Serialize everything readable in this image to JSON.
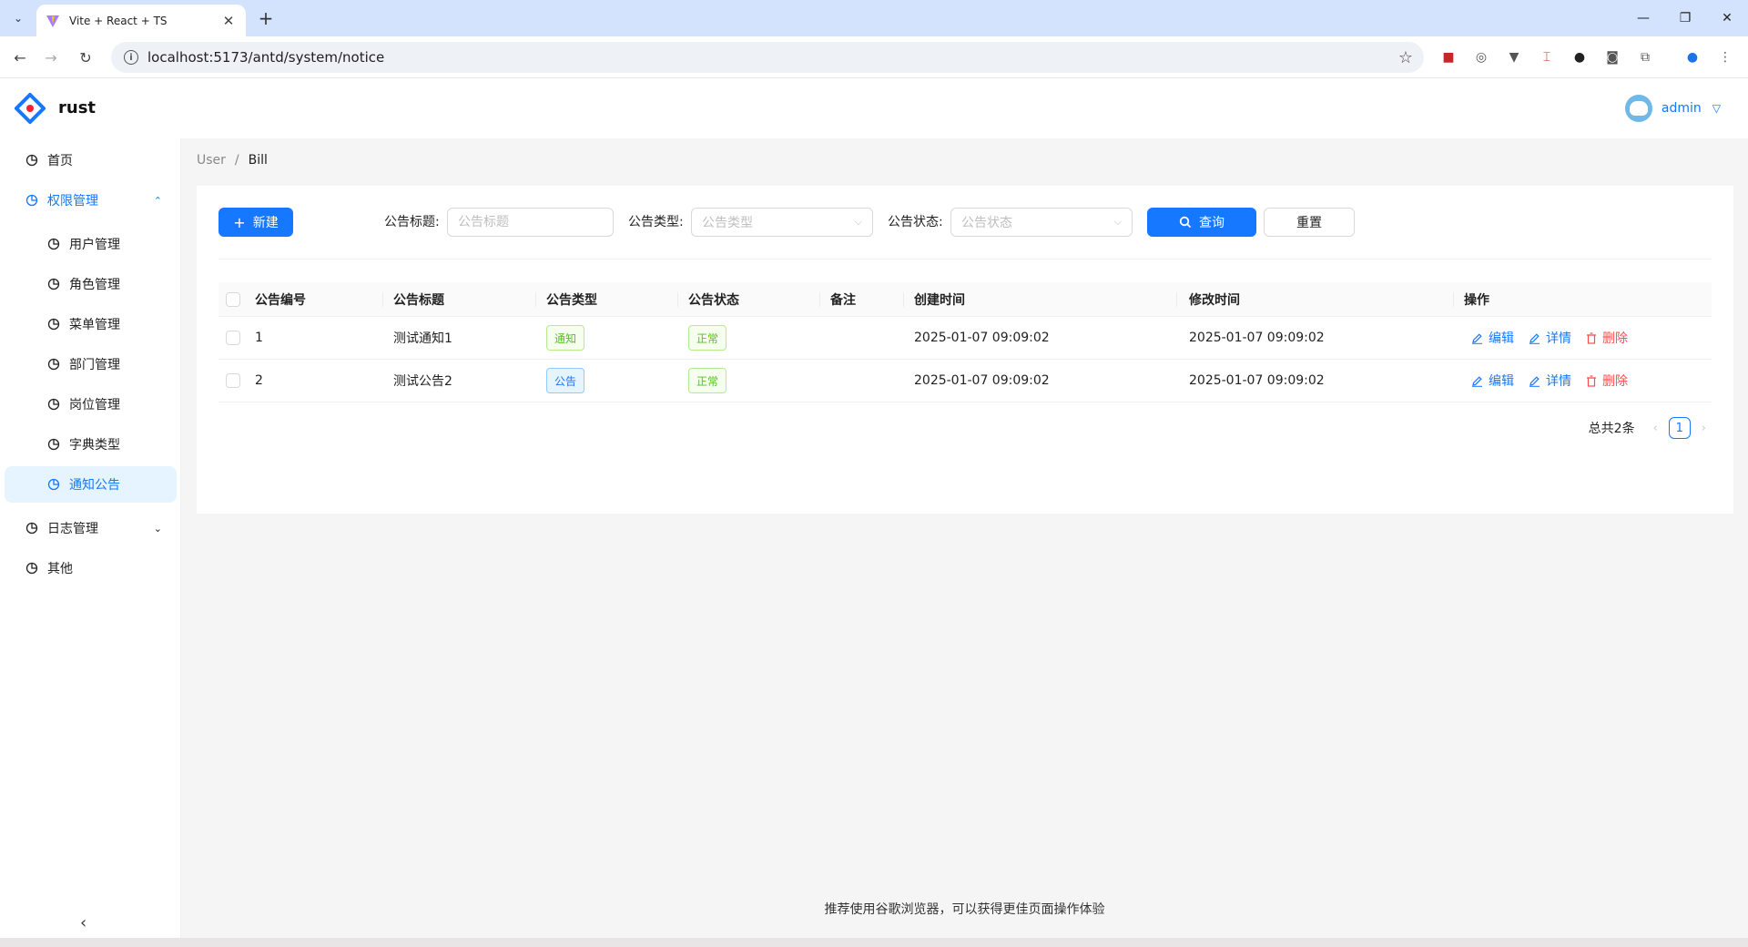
{
  "browser": {
    "tab_title": "Vite + React + TS",
    "url": "localhost:5173/antd/system/notice"
  },
  "header": {
    "brand": "rust",
    "user": "admin"
  },
  "sidebar": {
    "items": [
      {
        "label": "首页"
      },
      {
        "label": "权限管理"
      },
      {
        "label": "用户管理"
      },
      {
        "label": "角色管理"
      },
      {
        "label": "菜单管理"
      },
      {
        "label": "部门管理"
      },
      {
        "label": "岗位管理"
      },
      {
        "label": "字典类型"
      },
      {
        "label": "通知公告"
      },
      {
        "label": "日志管理"
      },
      {
        "label": "其他"
      }
    ]
  },
  "breadcrumb": {
    "parent": "User",
    "separator": "/",
    "current": "Bill"
  },
  "toolbar": {
    "new_label": "新建",
    "title_label": "公告标题:",
    "title_placeholder": "公告标题",
    "type_label": "公告类型:",
    "type_placeholder": "公告类型",
    "status_label": "公告状态:",
    "status_placeholder": "公告状态",
    "search_label": "查询",
    "reset_label": "重置"
  },
  "table": {
    "columns": [
      "公告编号",
      "公告标题",
      "公告类型",
      "公告状态",
      "备注",
      "创建时间",
      "修改时间",
      "操作"
    ],
    "rows": [
      {
        "id": "1",
        "title": "测试通知1",
        "type": "通知",
        "status": "正常",
        "remark": "",
        "created": "2025-01-07 09:09:02",
        "updated": "2025-01-07 09:09:02"
      },
      {
        "id": "2",
        "title": "测试公告2",
        "type": "公告",
        "status": "正常",
        "remark": "",
        "created": "2025-01-07 09:09:02",
        "updated": "2025-01-07 09:09:02"
      }
    ],
    "actions": {
      "edit": "编辑",
      "detail": "详情",
      "delete": "删除"
    }
  },
  "pagination": {
    "total": "总共2条",
    "current": "1"
  },
  "footer": {
    "text": "推荐使用谷歌浏览器，可以获得更佳页面操作体验"
  },
  "colors": {
    "primary": "#1677ff",
    "danger": "#ff4d4f",
    "success": "#52c41a"
  }
}
